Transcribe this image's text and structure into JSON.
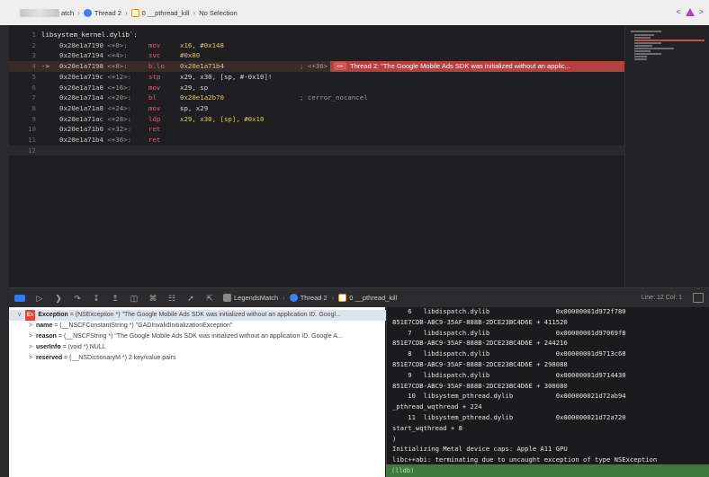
{
  "jumpbar": {
    "crumbs": [
      "atch",
      "Thread 2",
      "0 __pthread_kill",
      "No Selection"
    ],
    "nav_left": "<",
    "nav_right": ">"
  },
  "editor": {
    "lines": [
      {
        "n": "1",
        "text": "libsystem_kernel.dylib`:"
      },
      {
        "n": "2",
        "arrow": "",
        "addr": "0x20e1a7190",
        "off": "<+0>:",
        "mn": "mov",
        "op": "x16, #0x148"
      },
      {
        "n": "3",
        "arrow": "",
        "addr": "0x20e1a7194",
        "off": "<+4>:",
        "mn": "svc",
        "op": "#0x80"
      },
      {
        "n": "4",
        "arrow": "->",
        "addr": "0x20e1a7198",
        "off": "<+8>:",
        "mn": "b.lo",
        "op": "0x20e1a71b4",
        "comment": "; <+36>",
        "badge": "Thread 2: \"The Google Mobile Ads SDK was initialized without an applic..."
      },
      {
        "n": "5",
        "arrow": "",
        "addr": "0x20e1a719c",
        "off": "<+12>:",
        "mn": "stp",
        "op": "x29, x30, [sp, #-0x10]!"
      },
      {
        "n": "6",
        "arrow": "",
        "addr": "0x20e1a71a0",
        "off": "<+16>:",
        "mn": "mov",
        "op": "x29, sp"
      },
      {
        "n": "7",
        "arrow": "",
        "addr": "0x20e1a71a4",
        "off": "<+20>:",
        "mn": "bl",
        "op": "0x20e1a2b70",
        "comment": "; cerror_nocancel"
      },
      {
        "n": "8",
        "arrow": "",
        "addr": "0x20e1a71a8",
        "off": "<+24>:",
        "mn": "mov",
        "op": "sp, x29"
      },
      {
        "n": "9",
        "arrow": "",
        "addr": "0x20e1a71ac",
        "off": "<+28>:",
        "mn": "ldp",
        "op": "x29, x30, [sp], #0x10"
      },
      {
        "n": "10",
        "arrow": "",
        "addr": "0x20e1a71b0",
        "off": "<+32>:",
        "mn": "ret",
        "op": ""
      },
      {
        "n": "11",
        "arrow": "",
        "addr": "0x20e1a71b4",
        "off": "<+36>:",
        "mn": "ret",
        "op": ""
      },
      {
        "n": "12",
        "text": ""
      }
    ]
  },
  "debugbar": {
    "crumbs": [
      "LegendsMatch",
      "Thread 2",
      "0 __pthread_kill"
    ],
    "position": "Line: 12  Col: 1"
  },
  "variables": [
    {
      "indent": 0,
      "tri": "v",
      "badge": "Ex",
      "name": "Exception",
      "value": " = (NSException *) \"The Google Mobile Ads SDK was initialized without an application ID. Googl..."
    },
    {
      "indent": 1,
      "tri": ">",
      "name": "name",
      "value": " = (__NSCFConstantString *) \"GADInvalidInitializationException\""
    },
    {
      "indent": 1,
      "tri": ">",
      "name": "reason",
      "value": " = (__NSCFString *) \"The Google Mobile Ads SDK was initialized without an application ID. Google A..."
    },
    {
      "indent": 1,
      "tri": ">",
      "name": "userInfo",
      "value": " = (void *) NULL"
    },
    {
      "indent": 1,
      "tri": ">",
      "name": "reserved",
      "value": " = (__NSDictionaryM *) 2 key/value pairs"
    }
  ],
  "console": {
    "lines": [
      "    6   libdispatch.dylib                 0x00000001d972f780",
      "851E7CDB-ABC9-35AF-888B-2DCE23BC4D6E + 411520",
      "    7   libdispatch.dylib                 0x00000001d97069f8",
      "851E7CDB-ABC9-35AF-888B-2DCE23BC4D6E + 244216",
      "    8   libdispatch.dylib                 0x00000001d9713c68",
      "851E7CDB-ABC9-35AF-888B-2DCE23BC4D6E + 298088",
      "    9   libdispatch.dylib                 0x00000001d9714430",
      "851E7CDB-ABC9-35AF-888B-2DCE23BC4D6E + 300080",
      "    10  libsystem_pthread.dylib           0x000000021d72ab94",
      "_pthread_wqthread + 224",
      "    11  libsystem_pthread.dylib           0x000000021d72a720",
      "start_wqthread + 8",
      ")",
      "Initializing Metal device caps: Apple A11 GPU",
      "libc++abi: terminating due to uncaught exception of type NSException"
    ],
    "prompt": "(lldb)"
  },
  "colors": {
    "error_badge": "#b3423f",
    "mnemonic": "#e05c7a",
    "number": "#d9c87a",
    "lldb_bar": "#3e7a3e"
  }
}
